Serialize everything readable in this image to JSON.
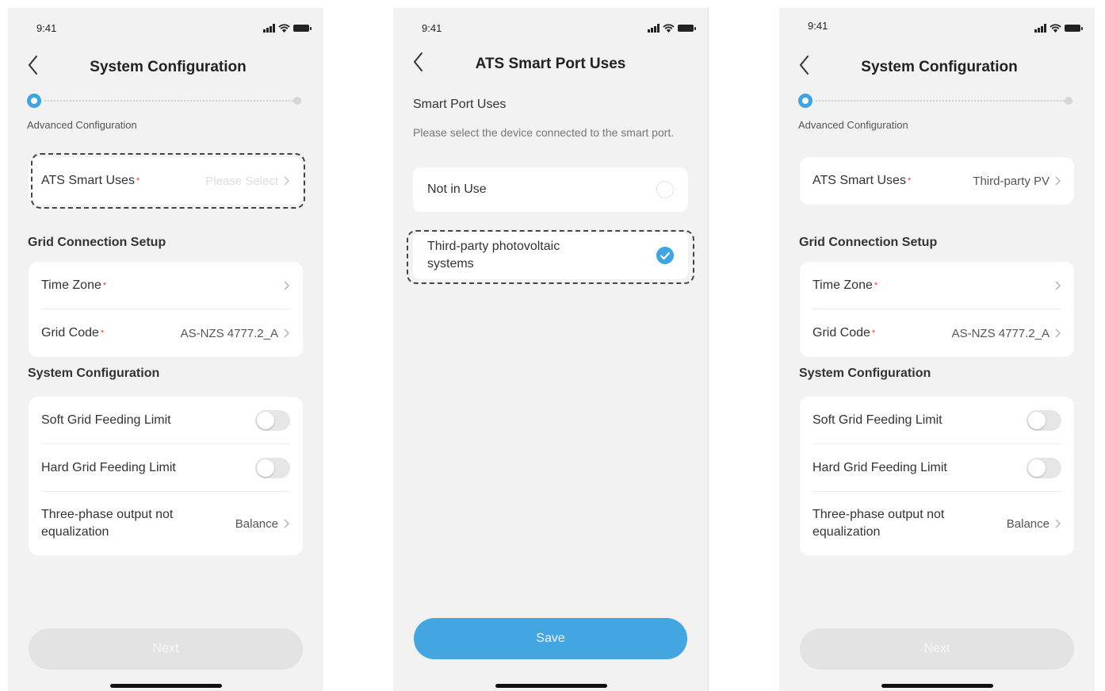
{
  "status_time": "9:41",
  "screen1": {
    "title": "System Configuration",
    "step_label": "Advanced Configuration",
    "ats_label": "ATS Smart Uses",
    "ats_value": "Please Select",
    "grid_section": "Grid Connection Setup",
    "time_zone_label": "Time Zone",
    "grid_code_label": "Grid Code",
    "grid_code_value": "AS-NZS 4777.2_A",
    "system_section": "System Configuration",
    "soft_limit_label": "Soft Grid Feeding Limit",
    "hard_limit_label": "Hard Grid Feeding Limit",
    "three_phase_label": "Three-phase output not equalization",
    "three_phase_value": "Balance",
    "next_label": "Next"
  },
  "screen2": {
    "time": "9:41",
    "title": "ATS Smart Port Uses",
    "heading": "Smart Port Uses",
    "description": "Please select the device connected to the smart port.",
    "options": [
      {
        "label": "Not in Use",
        "selected": false
      },
      {
        "label": "Third-party photovoltaic systems",
        "selected": true
      }
    ],
    "save_label": "Save"
  },
  "screen3": {
    "title": "System Configuration",
    "step_label": "Advanced Configuration",
    "ats_label": "ATS Smart Uses",
    "ats_value": "Third-party PV",
    "grid_section": "Grid Connection Setup",
    "time_zone_label": "Time Zone",
    "grid_code_label": "Grid Code",
    "grid_code_value": "AS-NZS 4777.2_A",
    "system_section": "System Configuration",
    "soft_limit_label": "Soft Grid Feeding Limit",
    "hard_limit_label": "Hard Grid Feeding Limit",
    "three_phase_label": "Three-phase output not equalization",
    "three_phase_value": "Balance",
    "next_label": "Next"
  },
  "required_mark": "*",
  "colors": {
    "accent": "#3ea5e0",
    "save_button": "#44a6e0",
    "required": "#e23b3b",
    "disabled_button": "#e3e3e3",
    "background": "#f2f2f2"
  },
  "toggles": {
    "soft_limit_on": false,
    "hard_limit_on": false
  }
}
